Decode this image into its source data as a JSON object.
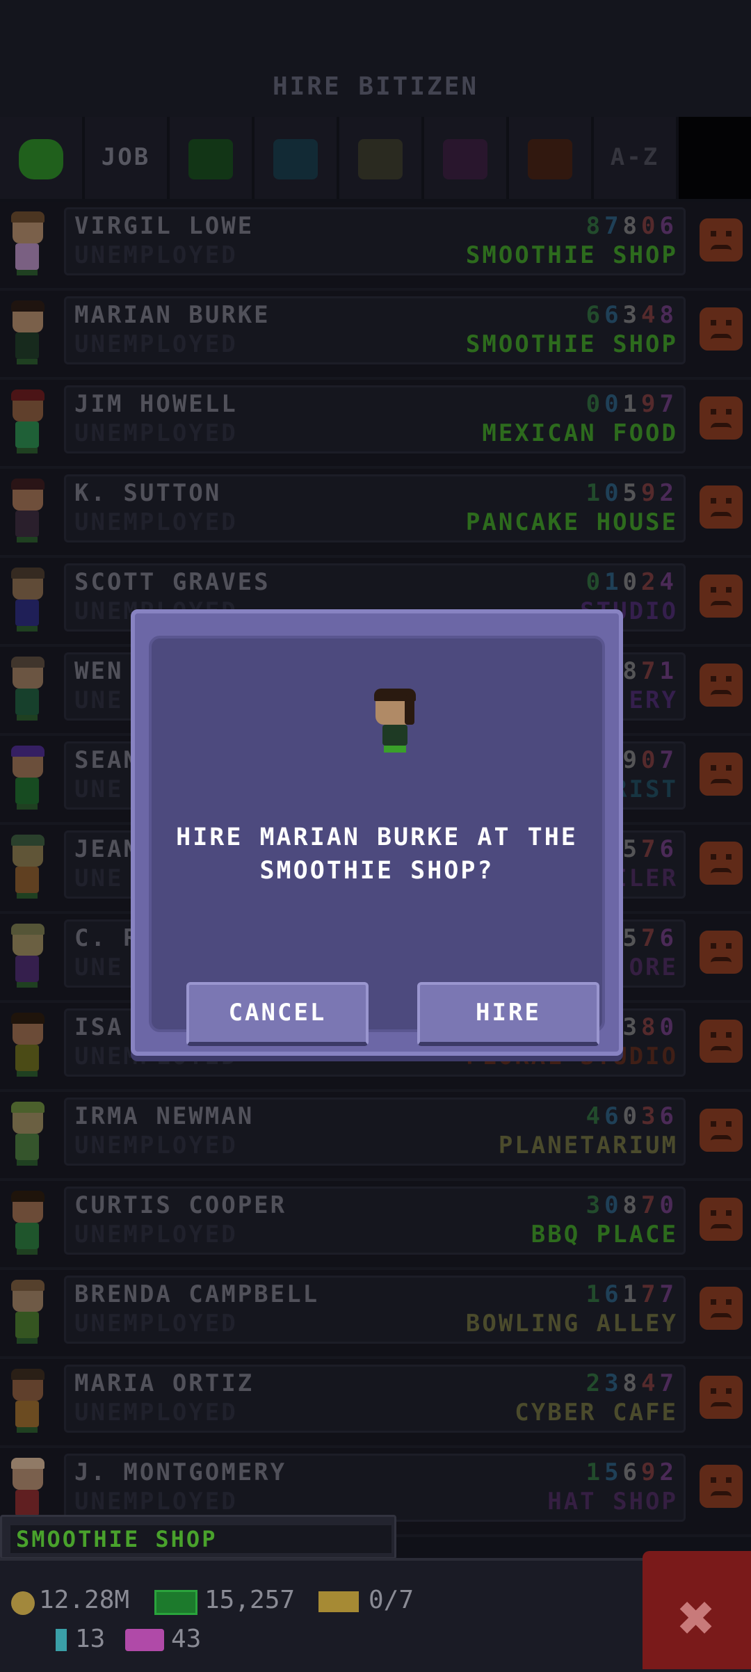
{
  "header": {
    "title": "HIRE BITIZEN"
  },
  "filters": [
    {
      "type": "face",
      "label": "",
      "color": "#2b8a22"
    },
    {
      "type": "text",
      "label": "JOB"
    },
    {
      "type": "swatch",
      "label": "",
      "color": "#174a1a"
    },
    {
      "type": "swatch",
      "label": "",
      "color": "#173a48"
    },
    {
      "type": "swatch",
      "label": "",
      "color": "#3a3a28"
    },
    {
      "type": "swatch",
      "label": "",
      "color": "#381c3c"
    },
    {
      "type": "swatch",
      "label": "",
      "color": "#45200f"
    },
    {
      "type": "text",
      "label": "A-Z"
    }
  ],
  "rows": [
    {
      "name": "VIRGIL LOWE",
      "status": "UNEMPLOYED",
      "number": "87806",
      "job": "SMOOTHIE SHOP",
      "job_color": "#3f9a24",
      "skin": "#b08a66",
      "hair": "#6a4a2a",
      "shirt": "#b08ab8"
    },
    {
      "name": "MARIAN BURKE",
      "status": "UNEMPLOYED",
      "number": "66348",
      "job": "SMOOTHIE SHOP",
      "job_color": "#3f9a24",
      "skin": "#b08a66",
      "hair": "#2a1a10",
      "shirt": "#1e3a24"
    },
    {
      "name": "JIM HOWELL",
      "status": "UNEMPLOYED",
      "number": "00197",
      "job": "MEXICAN FOOD",
      "job_color": "#3f9a24",
      "skin": "#8a5a3a",
      "hair": "#6a1a1a",
      "shirt": "#2a8a4a"
    },
    {
      "name": "K. SUTTON",
      "status": "UNEMPLOYED",
      "number": "10592",
      "job": "PANCAKE HOUSE",
      "job_color": "#3f9a24",
      "skin": "#a07050",
      "hair": "#3a1a1a",
      "shirt": "#3a2a3a"
    },
    {
      "name": "SCOTT GRAVES",
      "status": "UNEMPLOYED",
      "number": "01024",
      "job": "STUDIO",
      "job_color": "#4a2a6a",
      "skin": "#8a6a4a",
      "hair": "#4a3a2a",
      "shirt": "#2a2a7a"
    },
    {
      "name": "WEN",
      "status": "UNE",
      "number": "871",
      "job": "ERY",
      "job_color": "#4a2a6a",
      "skin": "#9a7a5a",
      "hair": "#5a4a3a",
      "shirt": "#1e5a3a"
    },
    {
      "name": "SEAN",
      "status": "UNE",
      "number": "907",
      "job": "RIST",
      "job_color": "#1e4a5a",
      "skin": "#9a7050",
      "hair": "#4a2a8a",
      "shirt": "#1e6a2a"
    },
    {
      "name": "JEAN",
      "status": "UNE",
      "number": "576",
      "job": "ILER",
      "job_color": "#4a2a5a",
      "skin": "#8a7a4a",
      "hair": "#3a5a3a",
      "shirt": "#8a5a2a"
    },
    {
      "name": "C. R",
      "status": "UNE",
      "number": "576",
      "job": "ORE",
      "job_color": "#4a2a5a",
      "skin": "#9a8a5a",
      "hair": "#7a7a4a",
      "shirt": "#4a2a6a"
    },
    {
      "name": "ISA",
      "status": "UNEMPLOYED",
      "number": "380",
      "job": "FLORAL STUDIO",
      "job_color": "#5a2a1a",
      "skin": "#9a6a4a",
      "hair": "#2a1a0a",
      "shirt": "#6a6a1a"
    },
    {
      "name": "IRMA NEWMAN",
      "status": "UNEMPLOYED",
      "number": "46036",
      "job": "PLANETARIUM",
      "job_color": "#6a6a3a",
      "skin": "#9a8a5a",
      "hair": "#6a8a3a",
      "shirt": "#4a7a3a"
    },
    {
      "name": "CURTIS COOPER",
      "status": "UNEMPLOYED",
      "number": "30870",
      "job": "BBQ PLACE",
      "job_color": "#3f9a24",
      "skin": "#9a6a4a",
      "hair": "#2a1a0a",
      "shirt": "#2a7a3a"
    },
    {
      "name": "BRENDA CAMPBELL",
      "status": "UNEMPLOYED",
      "number": "16177",
      "job": "BOWLING ALLEY",
      "job_color": "#6a6a3a",
      "skin": "#a08060",
      "hair": "#7a5a3a",
      "shirt": "#4a7a2a"
    },
    {
      "name": "MARIA ORTIZ",
      "status": "UNEMPLOYED",
      "number": "23847",
      "job": "CYBER CAFE",
      "job_color": "#6a6a3a",
      "skin": "#8a5a3a",
      "hair": "#3a2a1a",
      "shirt": "#9a6a2a"
    },
    {
      "name": "J. MONTGOMERY",
      "status": "UNEMPLOYED",
      "number": "15692",
      "job": "HAT SHOP",
      "job_color": "#4a2a5a",
      "skin": "#b08a6a",
      "hair": "#d0b090",
      "shirt": "#8a2a2a"
    }
  ],
  "dialog": {
    "message": "HIRE MARIAN BURKE AT THE SMOOTHIE SHOP?",
    "cancel_label": "CANCEL",
    "hire_label": "HIRE"
  },
  "bottom": {
    "selected_business": "SMOOTHIE SHOP",
    "coins": "12.28M",
    "bux": "15,257",
    "tickets": "0/7",
    "gems": "13",
    "tv": "43",
    "close_label": "✖"
  },
  "colors": {
    "accent_green": "#3f9a24",
    "dialog_bg": "#6c67a6",
    "close_red": "#7a1a1a"
  },
  "icons": [
    "smiley-icon",
    "sad-face-icon",
    "coin-icon",
    "bux-icon",
    "ticket-icon",
    "gem-icon",
    "tv-icon",
    "close-icon"
  ]
}
